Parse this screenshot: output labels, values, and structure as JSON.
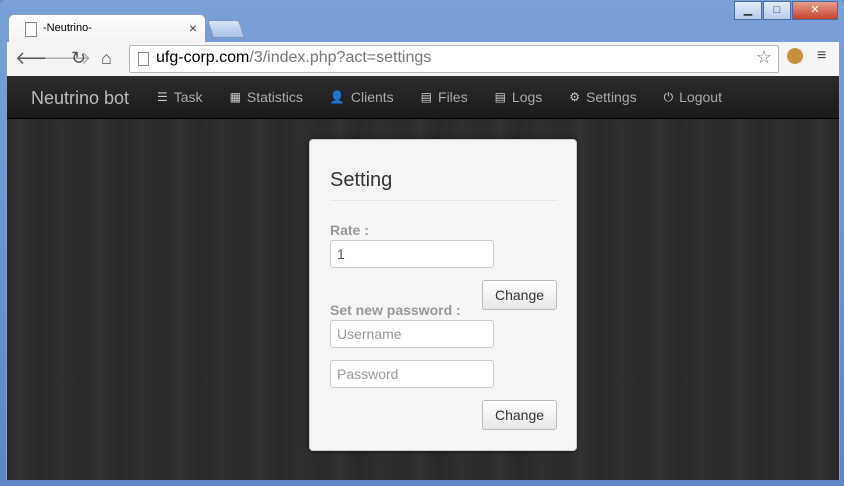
{
  "browser": {
    "tab_title": "-Neutrino-",
    "url_domain": "ufg-corp.com",
    "url_path": "/3/index.php?act=settings"
  },
  "navbar": {
    "brand": "Neutrino bot",
    "items": [
      {
        "label": "Task",
        "icon": "list-icon",
        "glyph": "☰"
      },
      {
        "label": "Statistics",
        "icon": "calendar-icon",
        "glyph": "▦"
      },
      {
        "label": "Clients",
        "icon": "user-icon",
        "glyph": "👤"
      },
      {
        "label": "Files",
        "icon": "file-list-icon",
        "glyph": "▤"
      },
      {
        "label": "Logs",
        "icon": "log-list-icon",
        "glyph": "▤"
      },
      {
        "label": "Settings",
        "icon": "gear-icon",
        "glyph": "⚙"
      },
      {
        "label": "Logout",
        "icon": "power-icon",
        "glyph": "⏻"
      }
    ]
  },
  "settings_form": {
    "title": "Setting",
    "rate_label": "Rate :",
    "rate_value": "1",
    "change_rate_button": "Change",
    "password_label": "Set new password :",
    "username_placeholder": "Username",
    "password_placeholder": "Password",
    "change_password_button": "Change"
  }
}
